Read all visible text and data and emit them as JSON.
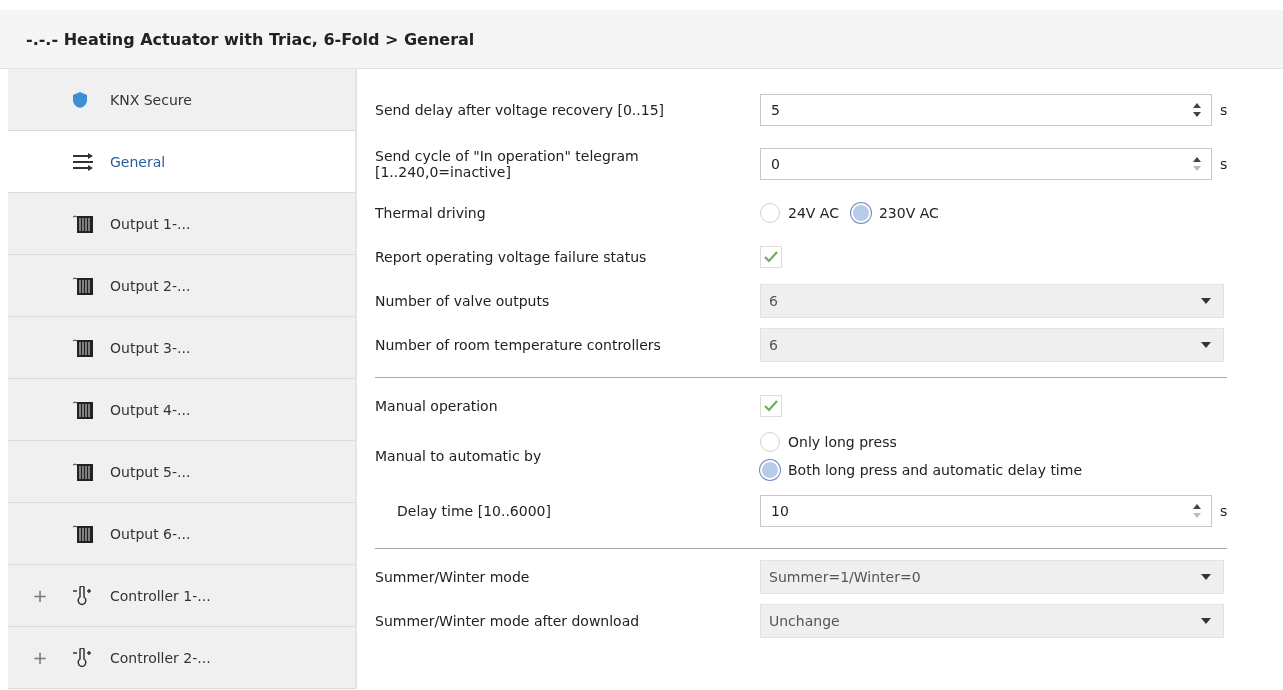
{
  "header": {
    "title": "-.-.- Heating Actuator with Triac, 6-Fold > General"
  },
  "sidebar": {
    "items": [
      {
        "label": "KNX Secure",
        "kind": "security",
        "selected": false
      },
      {
        "label": "General",
        "kind": "general",
        "selected": true
      },
      {
        "label": "Output 1-...",
        "kind": "output",
        "selected": false
      },
      {
        "label": "Output 2-...",
        "kind": "output",
        "selected": false
      },
      {
        "label": "Output 3-...",
        "kind": "output",
        "selected": false
      },
      {
        "label": "Output 4-...",
        "kind": "output",
        "selected": false
      },
      {
        "label": "Output 5-...",
        "kind": "output",
        "selected": false
      },
      {
        "label": "Output 6-...",
        "kind": "output",
        "selected": false
      },
      {
        "label": "Controller 1-...",
        "kind": "controller",
        "selected": false,
        "expander": "+"
      },
      {
        "label": "Controller 2-...",
        "kind": "controller",
        "selected": false,
        "expander": "+"
      }
    ]
  },
  "params": [
    {
      "kind": "spin",
      "label": "Send delay after voltage recovery [0..15]",
      "value": "5",
      "unit": "s",
      "down_disabled": false
    },
    {
      "kind": "spin",
      "label": "Send cycle of  \"In operation\" telegram [1..240,0=inactive]",
      "value": "0",
      "unit": "s",
      "down_disabled": true
    },
    {
      "kind": "radio_row",
      "label": "Thermal driving",
      "options": [
        {
          "label": "24V AC",
          "selected": false
        },
        {
          "label": "230V AC",
          "selected": true
        }
      ]
    },
    {
      "kind": "check",
      "label": "Report operating voltage failure status",
      "checked": true
    },
    {
      "kind": "select",
      "label": "Number of valve outputs",
      "value": "6",
      "disabled": true
    },
    {
      "kind": "select",
      "label": "Number of room temperature controllers",
      "value": "6",
      "disabled": true
    },
    {
      "kind": "divider"
    },
    {
      "kind": "check",
      "label": "Manual operation",
      "checked": true
    },
    {
      "kind": "radio_column",
      "label": "Manual to automatic by",
      "options": [
        {
          "label": "Only long press",
          "selected": false
        },
        {
          "label": "Both long press and automatic delay time",
          "selected": true
        }
      ],
      "children": [
        {
          "kind": "spin",
          "label": "Delay time [10..6000]",
          "value": "10",
          "unit": "s",
          "down_disabled": true
        }
      ]
    },
    {
      "kind": "divider"
    },
    {
      "kind": "select",
      "label": "Summer/Winter mode",
      "value": "Summer=1/Winter=0",
      "disabled": true
    },
    {
      "kind": "select",
      "label": "Summer/Winter mode after download",
      "value": "Unchange",
      "disabled": true
    }
  ]
}
